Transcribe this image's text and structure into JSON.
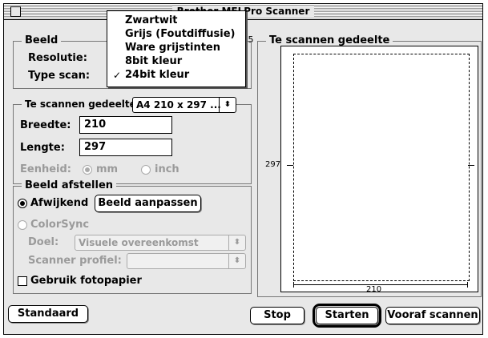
{
  "window": {
    "title": "Brother MFLPro Scanner",
    "version_fragment": "0.5"
  },
  "beeld": {
    "group_label": "Beeld",
    "resolutie_label": "Resolutie:",
    "type_scan_label": "Type scan:"
  },
  "scan_area": {
    "label": "Te scannen gedeelte",
    "value": "A4 210 x 297 ...",
    "breedte_label": "Breedte:",
    "breedte_value": "210",
    "lengte_label": "Lengte:",
    "lengte_value": "297",
    "eenheid_label": "Eenheid:",
    "unit_mm": "mm",
    "unit_inch": "inch"
  },
  "adjust": {
    "group_label": "Beeld afstellen",
    "afwijkend_label": "Afwijkend",
    "beeld_aanpassen_label": "Beeld aanpassen",
    "colorsync_label": "ColorSync",
    "doel_label": "Doel:",
    "doel_value": "Visuele overeenkomst",
    "scanner_profiel_label": "Scanner profiel:",
    "scanner_profiel_value": "",
    "fotopapier_label": "Gebruik fotopapier"
  },
  "preview": {
    "group_label": "Te scannen gedeelte",
    "width_label": "210",
    "height_label": "297"
  },
  "buttons": {
    "standaard": "Standaard",
    "stop": "Stop",
    "starten": "Starten",
    "vooraf": "Vooraf scannen"
  },
  "scan_type_menu": {
    "items": [
      "Zwartwit",
      "Grijs (Foutdiffusie)",
      "Ware grijstinten",
      "8bit kleur",
      "24bit kleur"
    ],
    "checked_mark": "✓"
  }
}
